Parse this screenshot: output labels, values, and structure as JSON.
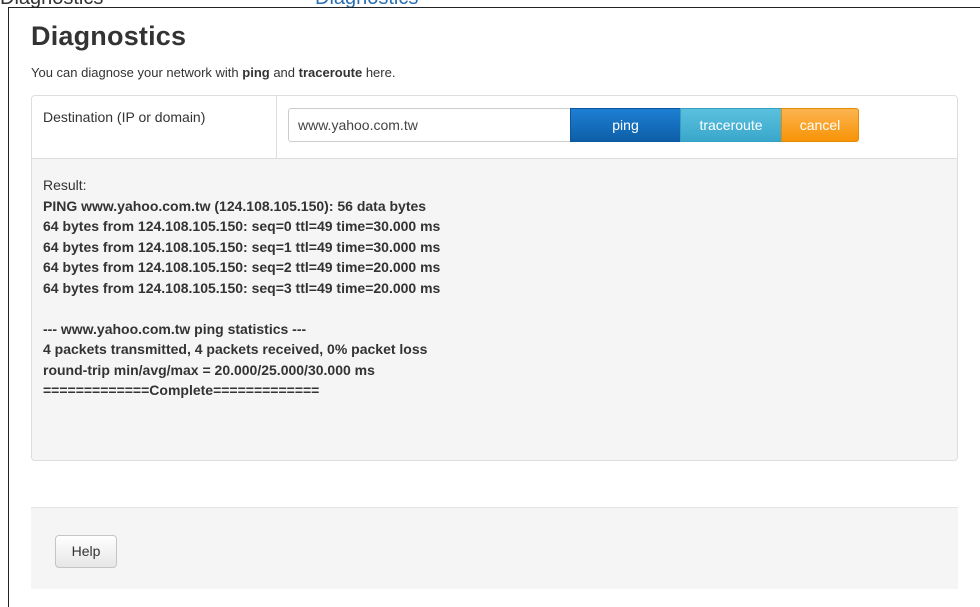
{
  "top_strip": {
    "left_text": "Diagnostics",
    "right_text": "Diagnostics"
  },
  "page": {
    "title": "Diagnostics",
    "subtitle_prefix": "You can diagnose your network with ",
    "subtitle_ping": "ping",
    "subtitle_and": " and ",
    "subtitle_traceroute": "traceroute",
    "subtitle_suffix": " here."
  },
  "form": {
    "destination_label": "Destination (IP or domain)",
    "destination_value": "www.yahoo.com.tw",
    "ping_label": "ping",
    "traceroute_label": "traceroute",
    "cancel_label": "cancel"
  },
  "result": {
    "label": "Result:",
    "lines": [
      "PING www.yahoo.com.tw (124.108.105.150): 56 data bytes",
      "64 bytes from 124.108.105.150: seq=0 ttl=49 time=30.000 ms",
      "64 bytes from 124.108.105.150: seq=1 ttl=49 time=30.000 ms",
      "64 bytes from 124.108.105.150: seq=2 ttl=49 time=20.000 ms",
      "64 bytes from 124.108.105.150: seq=3 ttl=49 time=20.000 ms",
      "",
      "--- www.yahoo.com.tw ping statistics ---",
      "4 packets transmitted, 4 packets received, 0% packet loss",
      "round-trip min/avg/max = 20.000/25.000/30.000 ms",
      "=============Complete============="
    ]
  },
  "footer": {
    "help_label": "Help"
  },
  "colors": {
    "ping_button": "#0e6ab9",
    "traceroute_button": "#46b4d6",
    "cancel_button": "#f99f1a"
  }
}
